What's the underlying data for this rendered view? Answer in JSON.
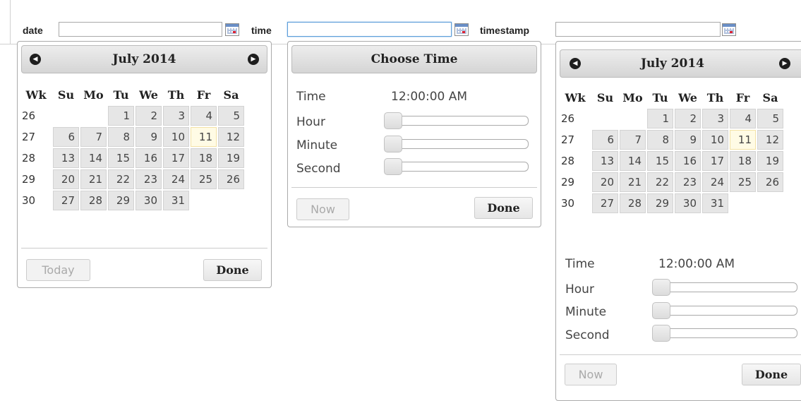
{
  "fields": {
    "date": {
      "label": "date",
      "value": ""
    },
    "time": {
      "label": "time",
      "value": ""
    },
    "timestamp": {
      "label": "timestamp",
      "value": ""
    }
  },
  "date_picker": {
    "month_title": "July 2014",
    "prev_icon": "circle-arrow-left-icon",
    "next_icon": "circle-arrow-right-icon",
    "weekday_headers": [
      "Wk",
      "Su",
      "Mo",
      "Tu",
      "We",
      "Th",
      "Fr",
      "Sa"
    ],
    "weeks": [
      {
        "wk": "26",
        "days": [
          "",
          "",
          "1",
          "2",
          "3",
          "4",
          "5"
        ]
      },
      {
        "wk": "27",
        "days": [
          "6",
          "7",
          "8",
          "9",
          "10",
          "11",
          "12"
        ]
      },
      {
        "wk": "28",
        "days": [
          "13",
          "14",
          "15",
          "16",
          "17",
          "18",
          "19"
        ]
      },
      {
        "wk": "29",
        "days": [
          "20",
          "21",
          "22",
          "23",
          "24",
          "25",
          "26"
        ]
      },
      {
        "wk": "30",
        "days": [
          "27",
          "28",
          "29",
          "30",
          "31",
          "",
          ""
        ]
      }
    ],
    "highlighted_day": "11",
    "today_label": "Today",
    "done_label": "Done"
  },
  "time_picker": {
    "title": "Choose Time",
    "time_label": "Time",
    "time_value": "12:00:00 AM",
    "hour_label": "Hour",
    "minute_label": "Minute",
    "second_label": "Second",
    "hour_level": 0,
    "minute_level": 0,
    "second_level": 0,
    "now_label": "Now",
    "done_label": "Done"
  },
  "timestamp_picker": {
    "month_title": "July 2014",
    "weekday_headers": [
      "Wk",
      "Su",
      "Mo",
      "Tu",
      "We",
      "Th",
      "Fr",
      "Sa"
    ],
    "weeks": [
      {
        "wk": "26",
        "days": [
          "",
          "",
          "1",
          "2",
          "3",
          "4",
          "5"
        ]
      },
      {
        "wk": "27",
        "days": [
          "6",
          "7",
          "8",
          "9",
          "10",
          "11",
          "12"
        ]
      },
      {
        "wk": "28",
        "days": [
          "13",
          "14",
          "15",
          "16",
          "17",
          "18",
          "19"
        ]
      },
      {
        "wk": "29",
        "days": [
          "20",
          "21",
          "22",
          "23",
          "24",
          "25",
          "26"
        ]
      },
      {
        "wk": "30",
        "days": [
          "27",
          "28",
          "29",
          "30",
          "31",
          "",
          ""
        ]
      }
    ],
    "highlighted_day": "11",
    "time_label": "Time",
    "time_value": "12:00:00 AM",
    "hour_label": "Hour",
    "minute_label": "Minute",
    "second_label": "Second",
    "hour_level": 0,
    "minute_level": 0,
    "second_level": 0,
    "now_label": "Now",
    "done_label": "Done"
  },
  "colors": {
    "highlight_day_bg": "#fffbe5",
    "focus_border": "#5b9dd9",
    "day_cell_bg": "#e6e6e6"
  }
}
